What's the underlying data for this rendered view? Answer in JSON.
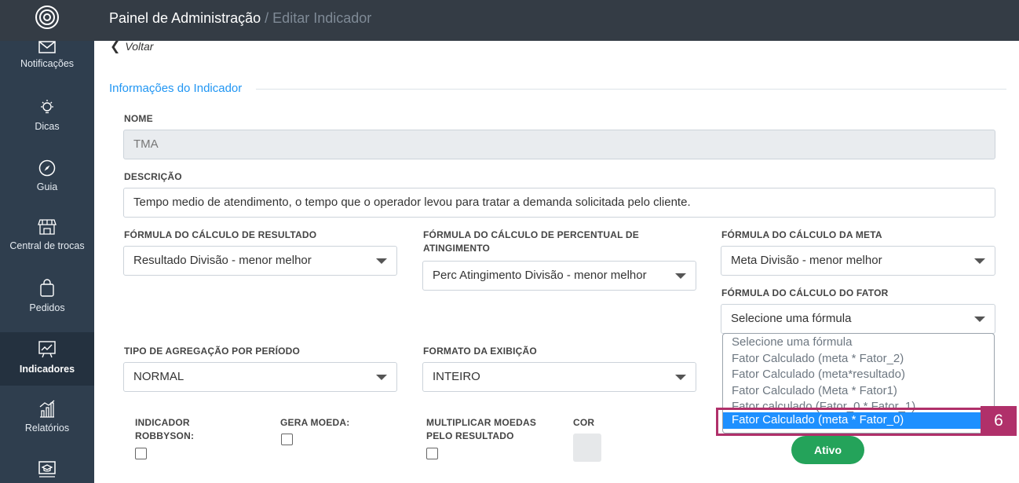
{
  "header": {
    "title": "Painel de Administração",
    "separator": "/",
    "subtitle": "Editar Indicador"
  },
  "sidebar": {
    "items": [
      {
        "label": "Notificações",
        "icon": "mail-icon"
      },
      {
        "label": "Dicas",
        "icon": "lightbulb-icon"
      },
      {
        "label": "Guia",
        "icon": "compass-icon"
      },
      {
        "label": "Central de trocas",
        "icon": "store-icon"
      },
      {
        "label": "Pedidos",
        "icon": "shopping-bag-icon"
      },
      {
        "label": "Indicadores",
        "icon": "chart-board-icon",
        "active": true
      },
      {
        "label": "Relatórios",
        "icon": "bar-chart-icon"
      },
      {
        "label": "",
        "icon": "monitor-hat-icon"
      }
    ]
  },
  "back_label": "Voltar",
  "section_title": "Informações do Indicador",
  "form": {
    "nome_label": "NOME",
    "nome_value": "TMA",
    "descricao_label": "DESCRIÇÃO",
    "descricao_value": "Tempo medio de atendimento, o tempo que o operador levou para tratar a demanda solicitada pelo cliente.",
    "formula_resultado_label": "FÓRMULA DO CÁLCULO DE RESULTADO",
    "formula_resultado_value": "Resultado Divisão - menor melhor",
    "formula_percentual_label_1": "FÓRMULA DO CÁLCULO DE PERCENTUAL DE",
    "formula_percentual_label_2": "ATINGIMENTO",
    "formula_percentual_value": "Perc Atingimento Divisão - menor melhor",
    "formula_meta_label": "FÓRMULA DO CÁLCULO DA META",
    "formula_meta_value": "Meta Divisão - menor melhor",
    "formula_fator_label": "FÓRMULA DO CÁLCULO DO FATOR",
    "formula_fator_value": "Selecione uma fórmula",
    "agregacao_label": "TIPO DE AGREGAÇÃO POR PERÍODO",
    "agregacao_value": "NORMAL",
    "formato_label": "FORMATO DA EXIBIÇÃO",
    "formato_value": "INTEIRO",
    "robbyson_label_1": "INDICADOR",
    "robbyson_label_2": "ROBBYSON:",
    "gera_moeda_label": "GERA MOEDA:",
    "multiplicar_label_1": "MULTIPLICAR MOEDAS",
    "multiplicar_label_2": "PELO RESULTADO",
    "cor_label": "COR",
    "ativo_label": "Ativo"
  },
  "fator_dropdown": {
    "options": [
      "Selecione uma fórmula",
      "Fator Calculado (meta * Fator_2)",
      "Fator Calculado (meta*resultado)",
      "Fator Calculado (Meta * Fator1)",
      "Fator calculado (Fator_0 * Fator_1)",
      "Fator Calculado (meta * Fator_0)"
    ],
    "selected_index": 5
  },
  "annotation": {
    "badge": "6",
    "color": "#b0306a"
  },
  "colors": {
    "accent": "#2196f3",
    "sidebar": "#2f3e4e",
    "topbar": "#343c45",
    "success": "#24a35a",
    "dropdown_selected": "#1e90ff"
  }
}
